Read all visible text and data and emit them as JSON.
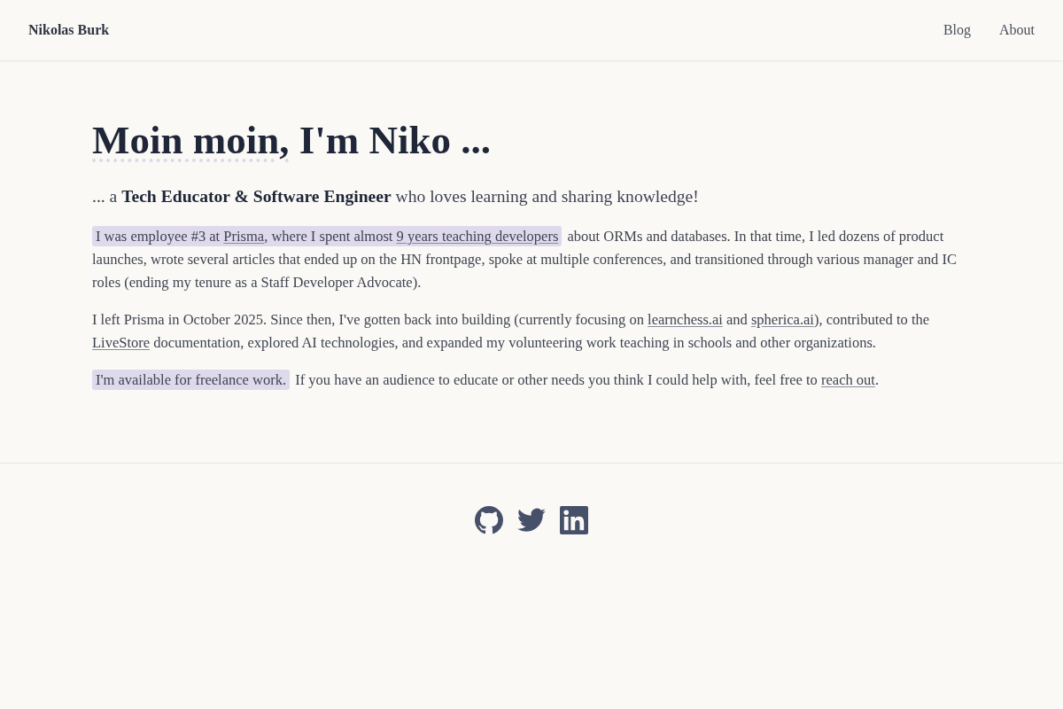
{
  "header": {
    "site_title": "Nikolas Burk",
    "nav": [
      {
        "label": "Blog"
      },
      {
        "label": "About"
      }
    ]
  },
  "title": {
    "parts": [
      {
        "text": "Moin moin,",
        "underlined": true
      },
      {
        "text": " I'm Niko ...",
        "underlined": false
      }
    ]
  },
  "subtitle": "... a **Tech Educator & Software Engineer** who loves learning and sharing knowledge!",
  "paragraphs": [
    {
      "segments": [
        {
          "kind": "highlight",
          "parts": [
            {
              "kind": "text",
              "text": "I was employee #3 at "
            },
            {
              "kind": "link",
              "text": "Prisma"
            },
            {
              "kind": "text",
              "text": ", where I spent almost "
            },
            {
              "kind": "link",
              "text": "9 years teaching developers"
            }
          ]
        },
        {
          "kind": "text",
          "text": " about ORMs and databases. In that time, I led dozens of product launches, wrote several articles that ended up on the HN frontpage, spoke at multiple conferences, and transitioned through various manager and IC roles (ending my tenure as a Staff Developer Advocate)."
        }
      ]
    },
    {
      "segments": [
        {
          "kind": "text",
          "text": "I left Prisma in October 2025. Since then, I've gotten back into building (currently focusing on "
        },
        {
          "kind": "link",
          "text": "learnchess.ai"
        },
        {
          "kind": "text",
          "text": " and "
        },
        {
          "kind": "link",
          "text": "spherica.ai"
        },
        {
          "kind": "text",
          "text": "), contributed to the "
        },
        {
          "kind": "link",
          "text": "LiveStore"
        },
        {
          "kind": "text",
          "text": " documentation, explored AI technologies, and expanded my volunteering work teaching in schools and other organizations."
        }
      ]
    },
    {
      "segments": [
        {
          "kind": "highlight",
          "parts": [
            {
              "kind": "text",
              "text": "I'm available for freelance work."
            }
          ]
        },
        {
          "kind": "text",
          "text": " If you have an audience to educate or other needs you think I could help with, feel free to "
        },
        {
          "kind": "link",
          "text": "reach out"
        },
        {
          "kind": "text",
          "text": "."
        }
      ]
    }
  ]
}
